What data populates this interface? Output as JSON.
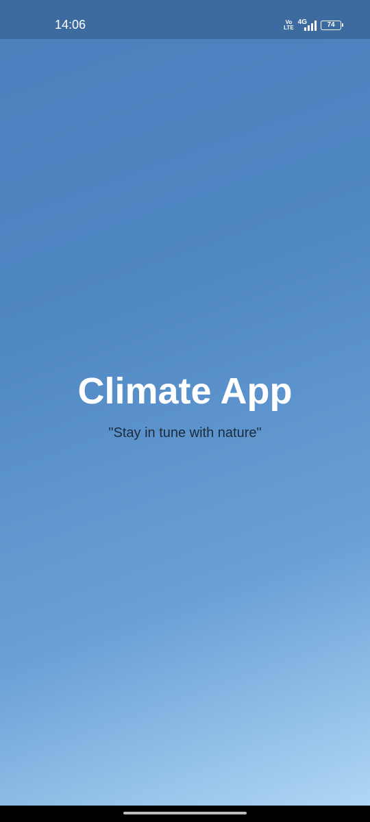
{
  "status_bar": {
    "time": "14:06",
    "volte_top": "Vo",
    "volte_bottom": "LTE",
    "network_type": "4G",
    "battery_level": "74"
  },
  "splash": {
    "title": "Climate App",
    "tagline": "\"Stay in tune with nature\""
  },
  "colors": {
    "status_bar_bg": "#3d6b9f",
    "gradient_start": "#4a7fbc",
    "gradient_end": "#b4daf6",
    "title_color": "#ffffff",
    "tagline_color": "#1c2a3a"
  },
  "icons": {
    "signal": "signal-strength-icon",
    "battery": "battery-icon",
    "volte": "volte-icon"
  }
}
